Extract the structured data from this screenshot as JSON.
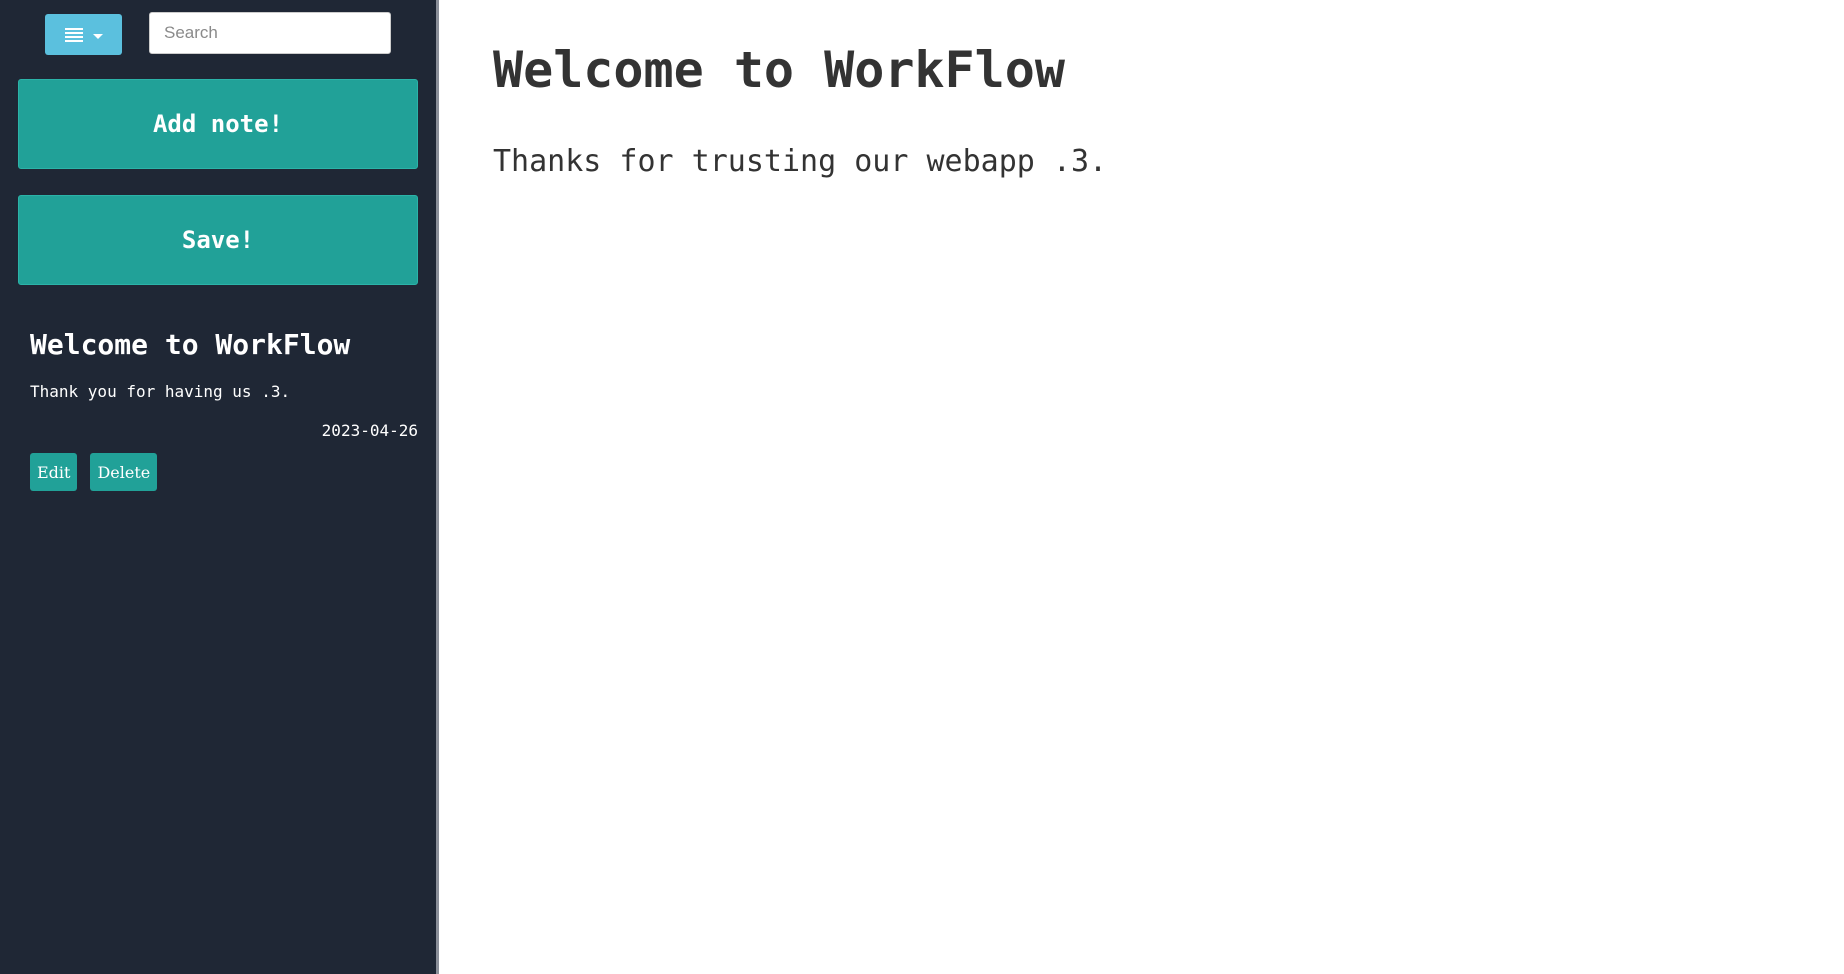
{
  "sidebar": {
    "menu_toggle": {
      "icon": "list-icon",
      "caret": "caret-down-icon",
      "color": "#5bc0de"
    },
    "search": {
      "placeholder": "Search",
      "value": ""
    },
    "add_note_label": "Add note!",
    "save_label": "Save!",
    "notes": [
      {
        "title": "Welcome to WorkFlow",
        "body": "Thank you for having us .3.",
        "date": "2023-04-26",
        "edit_label": "Edit",
        "delete_label": "Delete"
      }
    ],
    "background": "#1f2735",
    "accent": "#21a198"
  },
  "main": {
    "title": "Welcome to WorkFlow",
    "text": "Thanks for trusting our webapp .3."
  }
}
